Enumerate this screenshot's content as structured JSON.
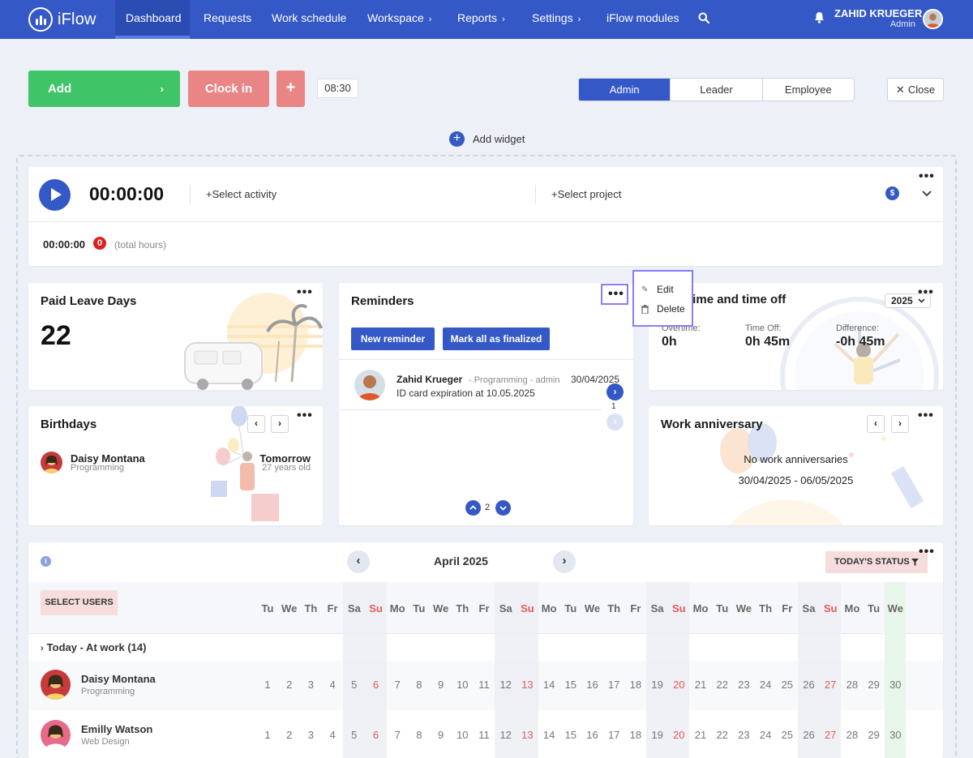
{
  "nav": {
    "logo_text": "iFlow",
    "items": [
      {
        "label": "Dashboard",
        "active": true
      },
      {
        "label": "Requests"
      },
      {
        "label": "Work schedule"
      },
      {
        "label": "Workspace",
        "chevron": "›"
      },
      {
        "label": "Reports",
        "chevron": "›"
      },
      {
        "label": "Settings",
        "chevron": "›"
      },
      {
        "label": "iFlow modules"
      }
    ],
    "user_name": "ZAHID KRUEGER",
    "user_role": "Admin"
  },
  "actions": {
    "add_label": "Add",
    "add_arrow": "›",
    "clock_in_label": "Clock in",
    "plus_label": "+",
    "time_chip": "08:30"
  },
  "role_switch": [
    "Admin",
    "Leader",
    "Employee"
  ],
  "close_label": "Close",
  "add_widget_label": "Add widget",
  "timer": {
    "value": "00:00:00",
    "select_activity": "Select activity",
    "select_project": "Select project",
    "total_time": "00:00:00",
    "badge": "0",
    "total_label": "(total hours)"
  },
  "paid_leave": {
    "title": "Paid Leave Days",
    "value": "22"
  },
  "reminders": {
    "title": "Reminders",
    "new_btn": "New reminder",
    "mark_btn": "Mark all as finalized",
    "item": {
      "name": "Zahid Krueger",
      "meta": "- Programming - admin",
      "date": "30/04/2025",
      "text": "ID card expiration at 10.05.2025"
    },
    "side_page": "1",
    "page": "2"
  },
  "popup": {
    "edit": "Edit",
    "delete": "Delete"
  },
  "overtime": {
    "title": "Overtime and time off",
    "year": "2025",
    "overtime_label": "Overtime:",
    "overtime_value": "0h",
    "timeoff_label": "Time Off:",
    "timeoff_value": "0h 45m",
    "diff_label": "Difference:",
    "diff_value": "-0h 45m"
  },
  "birthdays": {
    "title": "Birthdays",
    "name": "Daisy Montana",
    "dept": "Programming",
    "when": "Tomorrow",
    "age": "27 years old"
  },
  "anniversary": {
    "title": "Work anniversary",
    "empty": "No work anniversaries",
    "range": "30/04/2025 - 06/05/2025"
  },
  "calendar": {
    "month": "April 2025",
    "status_btn": "TODAY'S STATUS",
    "select_users": "SELECT USERS",
    "group_label": "Today - At work (14)",
    "days": [
      {
        "d": "Tu",
        "n": "1"
      },
      {
        "d": "We",
        "n": "2"
      },
      {
        "d": "Th",
        "n": "3"
      },
      {
        "d": "Fr",
        "n": "4"
      },
      {
        "d": "Sa",
        "n": "5"
      },
      {
        "d": "Su",
        "n": "6"
      },
      {
        "d": "Mo",
        "n": "7"
      },
      {
        "d": "Tu",
        "n": "8"
      },
      {
        "d": "We",
        "n": "9"
      },
      {
        "d": "Th",
        "n": "10"
      },
      {
        "d": "Fr",
        "n": "11"
      },
      {
        "d": "Sa",
        "n": "12"
      },
      {
        "d": "Su",
        "n": "13"
      },
      {
        "d": "Mo",
        "n": "14"
      },
      {
        "d": "Tu",
        "n": "15"
      },
      {
        "d": "We",
        "n": "16"
      },
      {
        "d": "Th",
        "n": "17"
      },
      {
        "d": "Fr",
        "n": "18"
      },
      {
        "d": "Sa",
        "n": "19"
      },
      {
        "d": "Su",
        "n": "20"
      },
      {
        "d": "Mo",
        "n": "21"
      },
      {
        "d": "Tu",
        "n": "22"
      },
      {
        "d": "We",
        "n": "23"
      },
      {
        "d": "Th",
        "n": "24"
      },
      {
        "d": "Fr",
        "n": "25"
      },
      {
        "d": "Sa",
        "n": "26"
      },
      {
        "d": "Su",
        "n": "27"
      },
      {
        "d": "Mo",
        "n": "28"
      },
      {
        "d": "Tu",
        "n": "29"
      },
      {
        "d": "We",
        "n": "30"
      }
    ],
    "users": [
      {
        "name": "Daisy Montana",
        "dept": "Programming"
      },
      {
        "name": "Emilly Watson",
        "dept": "Web Design"
      }
    ]
  },
  "colors": {
    "brand": "#3558c7",
    "green": "#3fc468",
    "salmon": "#e98585",
    "accent_purple": "#8a7cf5"
  }
}
